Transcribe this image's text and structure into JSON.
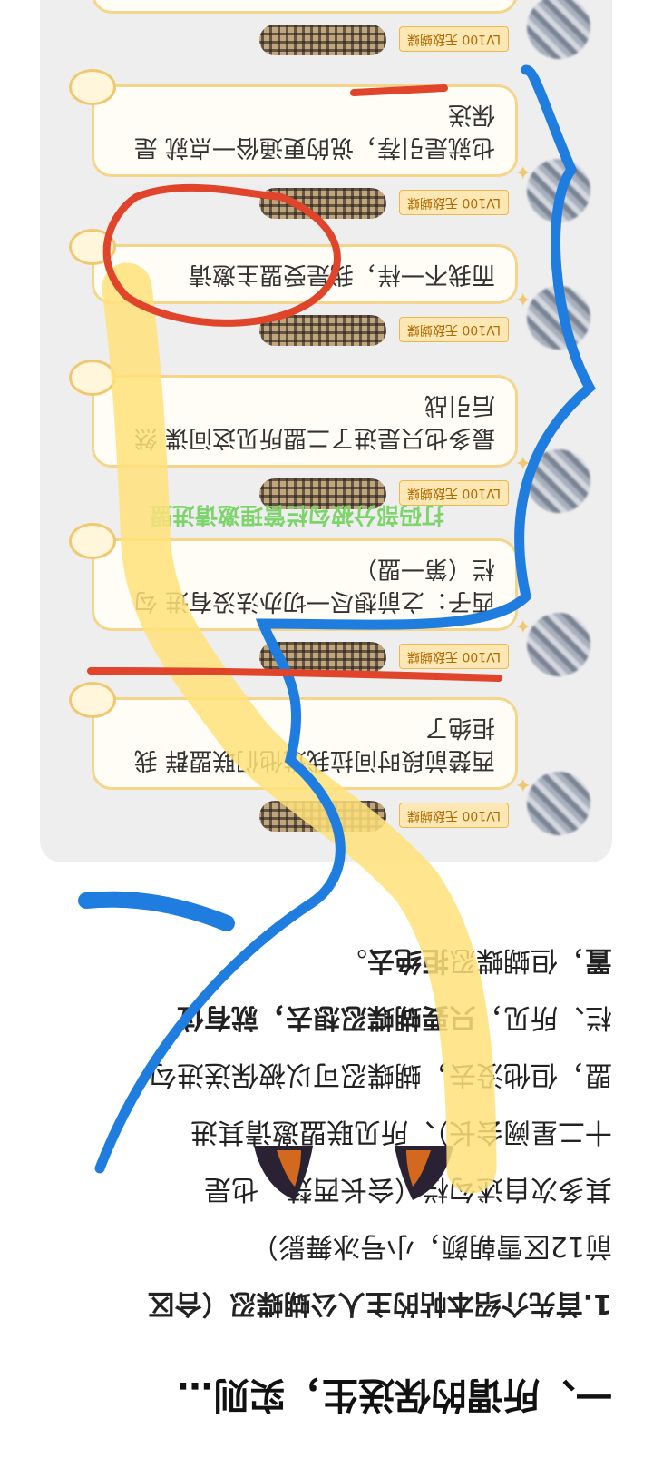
{
  "article": {
    "heading": "一、所谓的保送生，实则…",
    "paragraph": {
      "line1": "1.首先介绍本帖的主人公蝴蝶忍（合区",
      "line2": "前12区雪朝颜，小号冰舞影）",
      "line3": "其多次自述勾栏（会长西楚，也是",
      "line4": "十二星阙会长）、所见联盟邀请其进",
      "line5": "盟，但他没去，蝴蝶忍可以被保送进勾",
      "line6_normal": "栏、所见，",
      "line6_bold": "只要蝴蝶忍想去，就有位",
      "line7_bold_start": "置",
      "line7_normal": "，但蝴蝶忍",
      "line7_bold_end": "拒绝去",
      "line7_tail": "。"
    }
  },
  "chat": {
    "badge": "LV100 无敌蝴蝶",
    "messages": [
      {
        "text": "西楚前段时间拉我进他们联盟群 我拒绝了"
      },
      {
        "text": "西子：之前想尽一切办法没有进 勾栏（第一盟）"
      },
      {
        "text": "最多也只是进了二盟所见这间谍 然后引战"
      },
      {
        "text": "而我不一样，我是受盟主邀请"
      },
      {
        "text": "也就是引荐，说的更通俗一点就 是保送"
      }
    ],
    "green_note": "打码部分被勾栏管理邀请进盟"
  },
  "annotations": {
    "colors": {
      "blue": "#1f7de0",
      "red": "#e0442a",
      "yellow": "#ffe27a"
    }
  }
}
